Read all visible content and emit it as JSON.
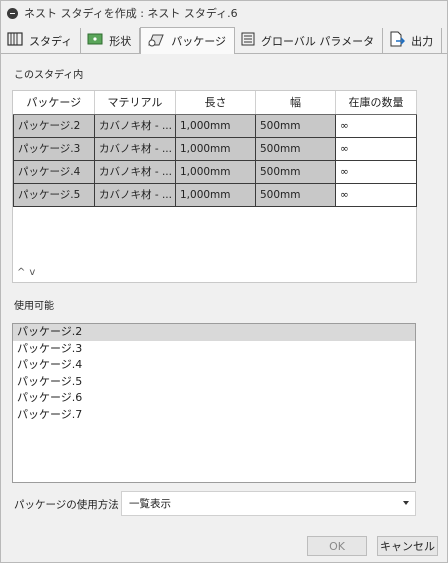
{
  "window": {
    "title": "ネスト スタディを作成 : ネスト スタディ.6"
  },
  "tabs": [
    {
      "label": "スタディ",
      "icon": "study-icon",
      "active": false
    },
    {
      "label": "形状",
      "icon": "shape-icon",
      "active": false
    },
    {
      "label": "パッケージ",
      "icon": "package-icon",
      "active": true
    },
    {
      "label": "グローバル パラメータ",
      "icon": "global-params-icon",
      "active": false
    },
    {
      "label": "出力",
      "icon": "output-icon",
      "active": false
    }
  ],
  "in_study": {
    "label": "このスタディ内",
    "columns": [
      "パッケージ",
      "マテリアル",
      "長さ",
      "幅",
      "在庫の数量"
    ],
    "rows": [
      {
        "package": "パッケージ.2",
        "material": "カバノキ材 - ...",
        "length": "1,000mm",
        "width": "500mm",
        "qty": "∞"
      },
      {
        "package": "パッケージ.3",
        "material": "カバノキ材 - ...",
        "length": "1,000mm",
        "width": "500mm",
        "qty": "∞"
      },
      {
        "package": "パッケージ.4",
        "material": "カバノキ材 - ...",
        "length": "1,000mm",
        "width": "500mm",
        "qty": "∞"
      },
      {
        "package": "パッケージ.5",
        "material": "カバノキ材 - ...",
        "length": "1,000mm",
        "width": "500mm",
        "qty": "∞"
      }
    ],
    "move_up": "^",
    "move_down": "v"
  },
  "available": {
    "label": "使用可能",
    "items": [
      "パッケージ.2",
      "パッケージ.3",
      "パッケージ.4",
      "パッケージ.5",
      "パッケージ.6",
      "パッケージ.7"
    ],
    "selected_index": 0
  },
  "usage": {
    "label": "パッケージの使用方法",
    "value": "一覧表示"
  },
  "buttons": {
    "ok": "OK",
    "cancel": "キャンセル"
  }
}
